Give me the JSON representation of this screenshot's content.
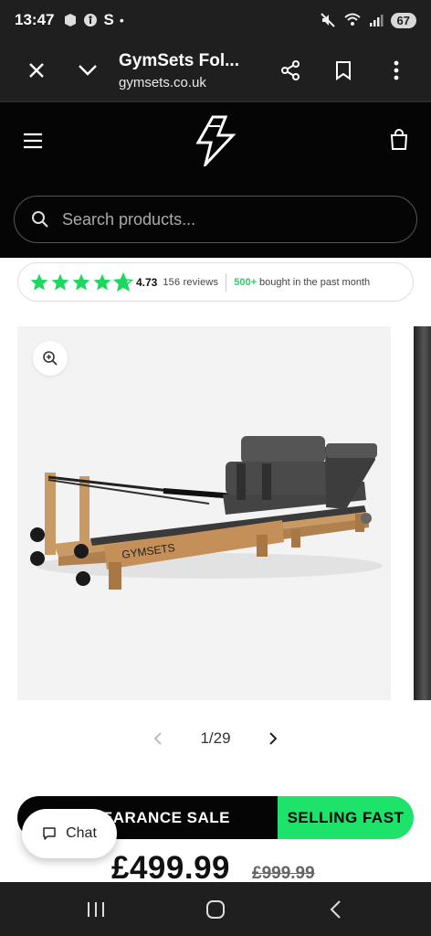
{
  "status_bar": {
    "time": "13:47",
    "carrier_letter": "S",
    "dot": "•",
    "battery": "67"
  },
  "browser": {
    "title": "GymSets Fol...",
    "url": "gymsets.co.uk"
  },
  "search": {
    "placeholder": "Search products..."
  },
  "reviews": {
    "rating": "4.73",
    "count": "156 reviews",
    "stars_filled": 4.73,
    "bought_count": "500+",
    "bought_text": "bought in the past month"
  },
  "product": {
    "brand_text": "GYMSETS"
  },
  "gallery": {
    "counter": "1/29"
  },
  "banner": {
    "left_text": "LEARANCE SALE",
    "right_text": "SELLING FAST"
  },
  "chat": {
    "label": "Chat"
  },
  "pricing": {
    "price": "£499.99",
    "old_price": "£999.99"
  },
  "colors": {
    "accent_green": "#1ee36b",
    "header_bg": "#050505",
    "browser_bg": "#1f1f1f"
  }
}
